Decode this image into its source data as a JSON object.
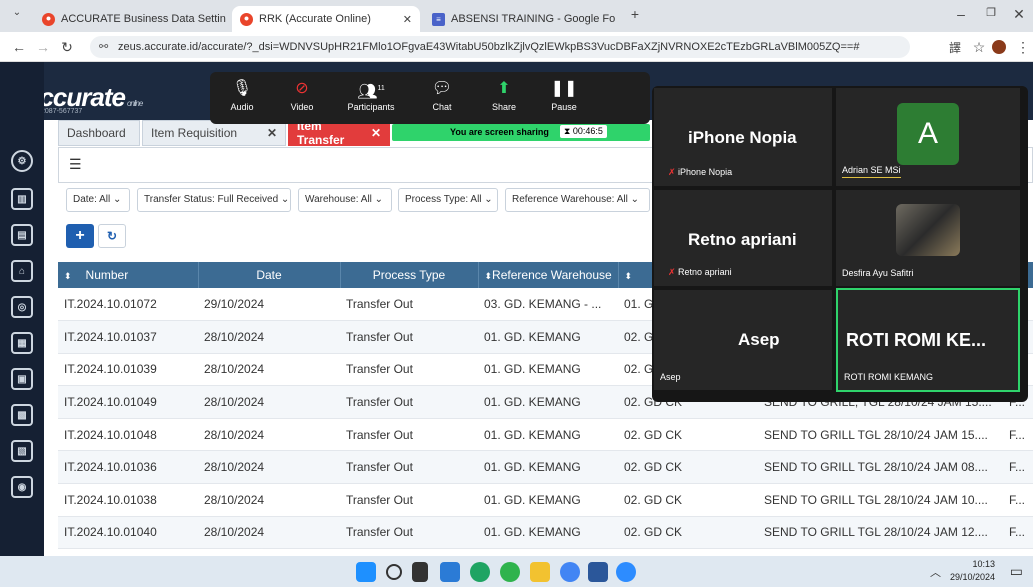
{
  "browser": {
    "tabs": [
      {
        "label": "ACCURATE Business Data Settin"
      },
      {
        "label": "RRK (Accurate Online)"
      },
      {
        "label": "ABSENSI TRAINING - Google Fo"
      }
    ],
    "url": "zeus.accurate.id/accurate/?_dsi=WDNVSUpHR21FMlo1OFgvaE43WitabU50bzlkZjlvQzlEWkpBS3VucDBFaXZjNVRNOXE2cTEzbGRLaVBlM005ZQ==#"
  },
  "app": {
    "logo": "accurate",
    "logo_tag": "online",
    "version": "v10.1#2087-567737"
  },
  "page_tabs": [
    {
      "label": "Dashboard"
    },
    {
      "label": "Item Requisition"
    },
    {
      "label": "Item Transfer"
    }
  ],
  "zoom": {
    "toolbar": [
      {
        "label": "Audio",
        "icon": "mic-icon"
      },
      {
        "label": "Video",
        "icon": "video-off-icon"
      },
      {
        "label": "Participants",
        "icon": "participants-icon",
        "count": "11"
      },
      {
        "label": "Chat",
        "icon": "chat-icon"
      },
      {
        "label": "Share",
        "icon": "share-icon"
      },
      {
        "label": "Pause",
        "icon": "pause-icon"
      }
    ],
    "banner": "You are screen sharing",
    "timer": "00:46:5",
    "participants": [
      {
        "big": "iPhone Nopia",
        "small": "iPhone Nopia"
      },
      {
        "big": "",
        "small": "Adrian SE MSi",
        "initial": "A"
      },
      {
        "big": "Retno apriani",
        "small": "Retno apriani"
      },
      {
        "big": "",
        "small": "Desfira Ayu Safitri"
      },
      {
        "big": "Asep",
        "small": "Asep"
      },
      {
        "big": "ROTI ROMI KE...",
        "small": "ROTI ROMI KEMANG"
      }
    ]
  },
  "filters": [
    {
      "label": "Date: All"
    },
    {
      "label": "Transfer Status: Full Received"
    },
    {
      "label": "Warehouse: All"
    },
    {
      "label": "Process Type: All"
    },
    {
      "label": "Reference Warehouse: All"
    }
  ],
  "table": {
    "headers": [
      "Number",
      "Date",
      "Process Type",
      "Reference Warehouse",
      "",
      "",
      ""
    ],
    "rows": [
      [
        "IT.2024.10.01072",
        "29/10/2024",
        "Transfer Out",
        "03. GD. KEMANG - ...",
        "01. G",
        "",
        ""
      ],
      [
        "IT.2024.10.01037",
        "28/10/2024",
        "Transfer Out",
        "01. GD. KEMANG",
        "02. G",
        "",
        ""
      ],
      [
        "IT.2024.10.01039",
        "28/10/2024",
        "Transfer Out",
        "01. GD. KEMANG",
        "02. G",
        "",
        ""
      ],
      [
        "IT.2024.10.01049",
        "28/10/2024",
        "Transfer Out",
        "01. GD. KEMANG",
        "02. GD CK",
        "SEND TO GRILL, TGL 28/10/24 JAM 15....",
        "F..."
      ],
      [
        "IT.2024.10.01048",
        "28/10/2024",
        "Transfer Out",
        "01. GD. KEMANG",
        "02. GD CK",
        "SEND TO GRILL TGL 28/10/24 JAM 15....",
        "F..."
      ],
      [
        "IT.2024.10.01036",
        "28/10/2024",
        "Transfer Out",
        "01. GD. KEMANG",
        "02. GD CK",
        "SEND TO GRILL TGL 28/10/24 JAM 08....",
        "F..."
      ],
      [
        "IT.2024.10.01038",
        "28/10/2024",
        "Transfer Out",
        "01. GD. KEMANG",
        "02. GD CK",
        "SEND TO GRILL TGL 28/10/24 JAM 10....",
        "F..."
      ],
      [
        "IT.2024.10.01040",
        "28/10/2024",
        "Transfer Out",
        "01. GD. KEMANG",
        "02. GD CK",
        "SEND TO GRILL TGL 28/10/24 JAM 12....",
        "F..."
      ]
    ]
  },
  "taskbar": {
    "time": "10:13",
    "date": "29/10/2024"
  }
}
